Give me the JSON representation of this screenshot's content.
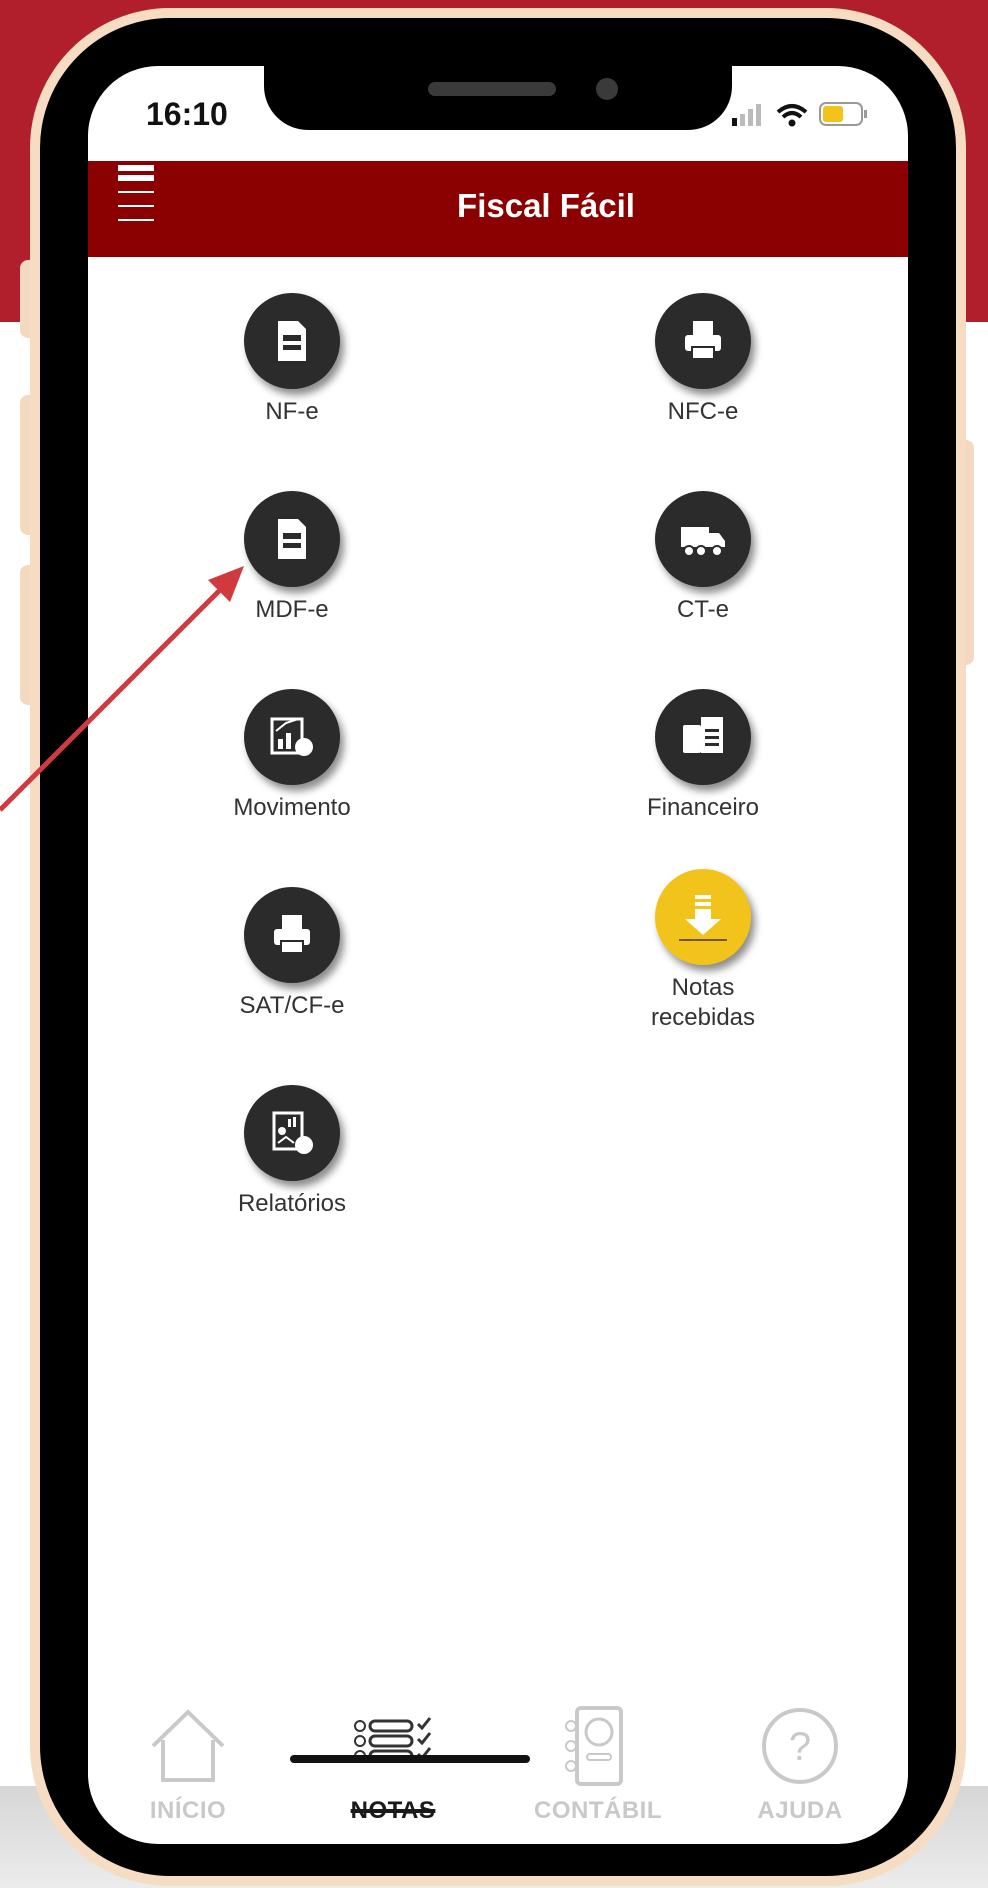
{
  "status_bar": {
    "time": "16:10"
  },
  "app_bar": {
    "title": "Fiscal Fácil",
    "menu_icon": "hamburger-menu-icon"
  },
  "tiles": [
    {
      "label": "NF-e",
      "icon": "nfe-document-icon",
      "style": "dark"
    },
    {
      "label": "NFC-e",
      "icon": "nfce-printer-icon",
      "style": "dark"
    },
    {
      "label": "MDF-e",
      "icon": "mdfe-document-icon",
      "style": "dark"
    },
    {
      "label": "CT-e",
      "icon": "cte-truck-icon",
      "style": "dark"
    },
    {
      "label": "Movimento",
      "icon": "movement-chart-icon",
      "style": "dark"
    },
    {
      "label": "Financeiro",
      "icon": "financial-calculator-icon",
      "style": "dark"
    },
    {
      "label": "SAT/CF-e",
      "icon": "sat-printer-icon",
      "style": "dark"
    },
    {
      "label": "Notas recebidas",
      "icon": "download-icon",
      "style": "yellow"
    },
    {
      "label": "Relatórios",
      "icon": "reports-icon",
      "style": "dark"
    }
  ],
  "tab_bar": {
    "items": [
      {
        "label": "INÍCIO",
        "icon": "home-icon",
        "active": false
      },
      {
        "label": "NOTAS",
        "icon": "list-check-icon",
        "active": true
      },
      {
        "label": "CONTÁBIL",
        "icon": "accounting-book-icon",
        "active": false
      },
      {
        "label": "AJUDA",
        "icon": "help-icon",
        "active": false
      }
    ]
  },
  "colors": {
    "brand_red": "#8b0000",
    "background_red": "#b01f2b",
    "accent_yellow": "#f2c41b",
    "arrow": "#d03a3f",
    "phone_frame": "#f6dcc2"
  }
}
